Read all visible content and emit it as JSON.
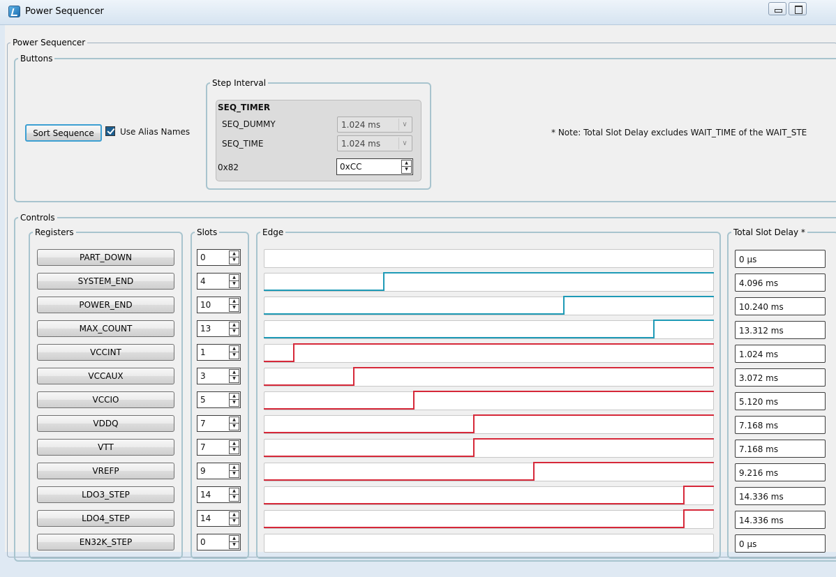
{
  "window": {
    "title": "Power Sequencer",
    "icon": "app-icon",
    "controls": [
      "minimize-icon",
      "maximize-icon"
    ]
  },
  "main_group": {
    "legend": "Power Sequencer",
    "buttons_group": {
      "legend": "Buttons",
      "sort_button": "Sort Sequence",
      "use_alias_label": "Use Alias Names",
      "use_alias_checked": true,
      "step_interval": {
        "legend": "Step Interval",
        "title": "SEQ_TIMER",
        "seq_dummy_label": "SEQ_DUMMY",
        "seq_dummy_value": "1.024 ms",
        "seq_time_label": "SEQ_TIME",
        "seq_time_value": "1.024 ms",
        "addr_label": "0x82",
        "addr_value": "0xCC"
      },
      "note": "* Note: Total Slot Delay excludes WAIT_TIME of the WAIT_STE"
    },
    "controls_group": {
      "legend": "Controls",
      "registers_legend": "Registers",
      "slots_legend": "Slots",
      "edge_legend": "Edge",
      "delay_legend": "Total Slot Delay *",
      "colors": {
        "teal": "#1e9ab6",
        "red": "#d62839"
      },
      "rows": [
        {
          "name": "PART_DOWN",
          "slot": "0",
          "delay": "0 µs",
          "color": "none"
        },
        {
          "name": "SYSTEM_END",
          "slot": "4",
          "delay": "4.096 ms",
          "color": "teal"
        },
        {
          "name": "POWER_END",
          "slot": "10",
          "delay": "10.240 ms",
          "color": "teal"
        },
        {
          "name": "MAX_COUNT",
          "slot": "13",
          "delay": "13.312 ms",
          "color": "teal"
        },
        {
          "name": "VCCINT",
          "slot": "1",
          "delay": "1.024 ms",
          "color": "red"
        },
        {
          "name": "VCCAUX",
          "slot": "3",
          "delay": "3.072 ms",
          "color": "red"
        },
        {
          "name": "VCCIO",
          "slot": "5",
          "delay": "5.120 ms",
          "color": "red"
        },
        {
          "name": "VDDQ",
          "slot": "7",
          "delay": "7.168 ms",
          "color": "red"
        },
        {
          "name": "VTT",
          "slot": "7",
          "delay": "7.168 ms",
          "color": "red"
        },
        {
          "name": "VREFP",
          "slot": "9",
          "delay": "9.216 ms",
          "color": "red"
        },
        {
          "name": "LDO3_STEP",
          "slot": "14",
          "delay": "14.336 ms",
          "color": "red"
        },
        {
          "name": "LDO4_STEP",
          "slot": "14",
          "delay": "14.336 ms",
          "color": "red"
        },
        {
          "name": "EN32K_STEP",
          "slot": "0",
          "delay": "0 µs",
          "color": "none"
        }
      ]
    }
  }
}
